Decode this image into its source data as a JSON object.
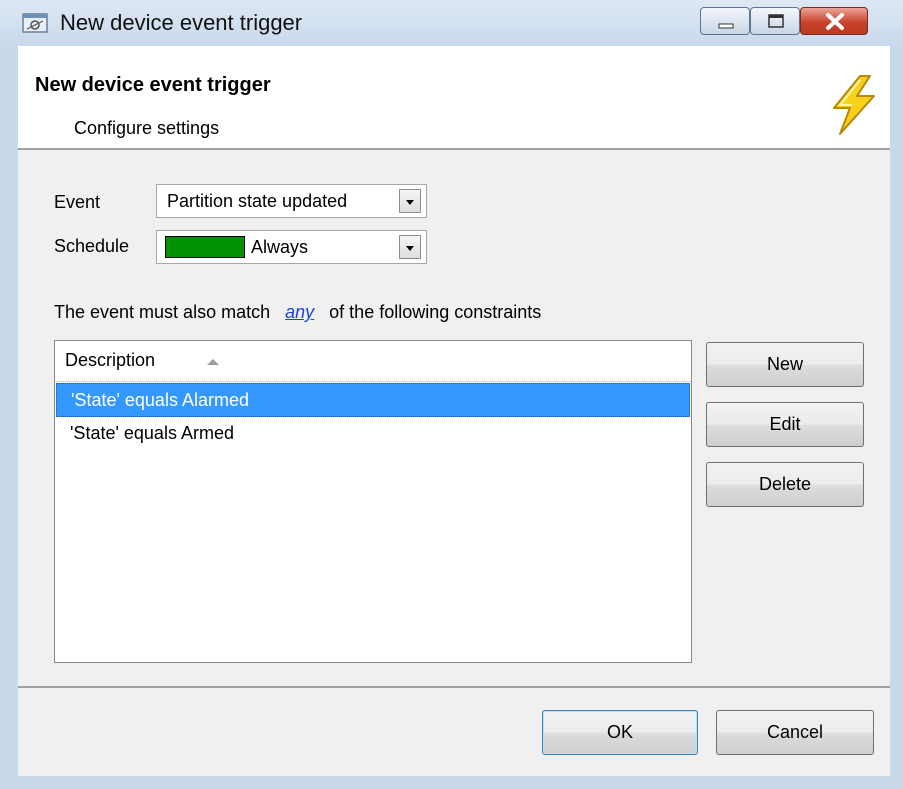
{
  "window": {
    "title": "New device event trigger",
    "controls": {
      "minimize": "minimize",
      "maximize": "maximize",
      "close": "close"
    }
  },
  "header": {
    "title": "New device event trigger",
    "subtitle": "Configure settings",
    "icon": "lightning-bolt-icon"
  },
  "form": {
    "event_label": "Event",
    "event_value": "Partition state updated",
    "schedule_label": "Schedule",
    "schedule_value": "Always",
    "schedule_color": "#009000"
  },
  "constraints": {
    "prefix": "The event must also match",
    "match_mode": "any",
    "suffix": "of the following constraints",
    "column_header": "Description",
    "rows": [
      {
        "text": "'State' equals Alarmed",
        "selected": true
      },
      {
        "text": "'State' equals Armed",
        "selected": false
      }
    ]
  },
  "side_buttons": {
    "new": "New",
    "edit": "Edit",
    "delete": "Delete"
  },
  "footer_buttons": {
    "ok": "OK",
    "cancel": "Cancel"
  },
  "colors": {
    "selection": "#3399ff",
    "link": "#1a44d6",
    "close_button": "#c9432c"
  }
}
